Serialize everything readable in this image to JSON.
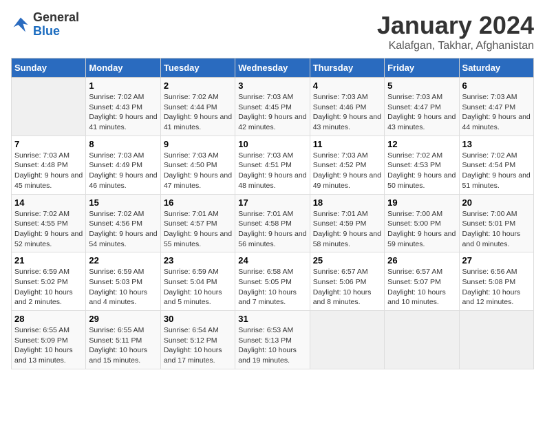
{
  "logo": {
    "general": "General",
    "blue": "Blue"
  },
  "title": "January 2024",
  "subtitle": "Kalafgan, Takhar, Afghanistan",
  "days_of_week": [
    "Sunday",
    "Monday",
    "Tuesday",
    "Wednesday",
    "Thursday",
    "Friday",
    "Saturday"
  ],
  "weeks": [
    [
      {
        "day": "",
        "sunrise": "",
        "sunset": "",
        "daylight": ""
      },
      {
        "day": "1",
        "sunrise": "Sunrise: 7:02 AM",
        "sunset": "Sunset: 4:43 PM",
        "daylight": "Daylight: 9 hours and 41 minutes."
      },
      {
        "day": "2",
        "sunrise": "Sunrise: 7:02 AM",
        "sunset": "Sunset: 4:44 PM",
        "daylight": "Daylight: 9 hours and 41 minutes."
      },
      {
        "day": "3",
        "sunrise": "Sunrise: 7:03 AM",
        "sunset": "Sunset: 4:45 PM",
        "daylight": "Daylight: 9 hours and 42 minutes."
      },
      {
        "day": "4",
        "sunrise": "Sunrise: 7:03 AM",
        "sunset": "Sunset: 4:46 PM",
        "daylight": "Daylight: 9 hours and 43 minutes."
      },
      {
        "day": "5",
        "sunrise": "Sunrise: 7:03 AM",
        "sunset": "Sunset: 4:47 PM",
        "daylight": "Daylight: 9 hours and 43 minutes."
      },
      {
        "day": "6",
        "sunrise": "Sunrise: 7:03 AM",
        "sunset": "Sunset: 4:47 PM",
        "daylight": "Daylight: 9 hours and 44 minutes."
      }
    ],
    [
      {
        "day": "7",
        "sunrise": "Sunrise: 7:03 AM",
        "sunset": "Sunset: 4:48 PM",
        "daylight": "Daylight: 9 hours and 45 minutes."
      },
      {
        "day": "8",
        "sunrise": "Sunrise: 7:03 AM",
        "sunset": "Sunset: 4:49 PM",
        "daylight": "Daylight: 9 hours and 46 minutes."
      },
      {
        "day": "9",
        "sunrise": "Sunrise: 7:03 AM",
        "sunset": "Sunset: 4:50 PM",
        "daylight": "Daylight: 9 hours and 47 minutes."
      },
      {
        "day": "10",
        "sunrise": "Sunrise: 7:03 AM",
        "sunset": "Sunset: 4:51 PM",
        "daylight": "Daylight: 9 hours and 48 minutes."
      },
      {
        "day": "11",
        "sunrise": "Sunrise: 7:03 AM",
        "sunset": "Sunset: 4:52 PM",
        "daylight": "Daylight: 9 hours and 49 minutes."
      },
      {
        "day": "12",
        "sunrise": "Sunrise: 7:02 AM",
        "sunset": "Sunset: 4:53 PM",
        "daylight": "Daylight: 9 hours and 50 minutes."
      },
      {
        "day": "13",
        "sunrise": "Sunrise: 7:02 AM",
        "sunset": "Sunset: 4:54 PM",
        "daylight": "Daylight: 9 hours and 51 minutes."
      }
    ],
    [
      {
        "day": "14",
        "sunrise": "Sunrise: 7:02 AM",
        "sunset": "Sunset: 4:55 PM",
        "daylight": "Daylight: 9 hours and 52 minutes."
      },
      {
        "day": "15",
        "sunrise": "Sunrise: 7:02 AM",
        "sunset": "Sunset: 4:56 PM",
        "daylight": "Daylight: 9 hours and 54 minutes."
      },
      {
        "day": "16",
        "sunrise": "Sunrise: 7:01 AM",
        "sunset": "Sunset: 4:57 PM",
        "daylight": "Daylight: 9 hours and 55 minutes."
      },
      {
        "day": "17",
        "sunrise": "Sunrise: 7:01 AM",
        "sunset": "Sunset: 4:58 PM",
        "daylight": "Daylight: 9 hours and 56 minutes."
      },
      {
        "day": "18",
        "sunrise": "Sunrise: 7:01 AM",
        "sunset": "Sunset: 4:59 PM",
        "daylight": "Daylight: 9 hours and 58 minutes."
      },
      {
        "day": "19",
        "sunrise": "Sunrise: 7:00 AM",
        "sunset": "Sunset: 5:00 PM",
        "daylight": "Daylight: 9 hours and 59 minutes."
      },
      {
        "day": "20",
        "sunrise": "Sunrise: 7:00 AM",
        "sunset": "Sunset: 5:01 PM",
        "daylight": "Daylight: 10 hours and 0 minutes."
      }
    ],
    [
      {
        "day": "21",
        "sunrise": "Sunrise: 6:59 AM",
        "sunset": "Sunset: 5:02 PM",
        "daylight": "Daylight: 10 hours and 2 minutes."
      },
      {
        "day": "22",
        "sunrise": "Sunrise: 6:59 AM",
        "sunset": "Sunset: 5:03 PM",
        "daylight": "Daylight: 10 hours and 4 minutes."
      },
      {
        "day": "23",
        "sunrise": "Sunrise: 6:59 AM",
        "sunset": "Sunset: 5:04 PM",
        "daylight": "Daylight: 10 hours and 5 minutes."
      },
      {
        "day": "24",
        "sunrise": "Sunrise: 6:58 AM",
        "sunset": "Sunset: 5:05 PM",
        "daylight": "Daylight: 10 hours and 7 minutes."
      },
      {
        "day": "25",
        "sunrise": "Sunrise: 6:57 AM",
        "sunset": "Sunset: 5:06 PM",
        "daylight": "Daylight: 10 hours and 8 minutes."
      },
      {
        "day": "26",
        "sunrise": "Sunrise: 6:57 AM",
        "sunset": "Sunset: 5:07 PM",
        "daylight": "Daylight: 10 hours and 10 minutes."
      },
      {
        "day": "27",
        "sunrise": "Sunrise: 6:56 AM",
        "sunset": "Sunset: 5:08 PM",
        "daylight": "Daylight: 10 hours and 12 minutes."
      }
    ],
    [
      {
        "day": "28",
        "sunrise": "Sunrise: 6:55 AM",
        "sunset": "Sunset: 5:09 PM",
        "daylight": "Daylight: 10 hours and 13 minutes."
      },
      {
        "day": "29",
        "sunrise": "Sunrise: 6:55 AM",
        "sunset": "Sunset: 5:11 PM",
        "daylight": "Daylight: 10 hours and 15 minutes."
      },
      {
        "day": "30",
        "sunrise": "Sunrise: 6:54 AM",
        "sunset": "Sunset: 5:12 PM",
        "daylight": "Daylight: 10 hours and 17 minutes."
      },
      {
        "day": "31",
        "sunrise": "Sunrise: 6:53 AM",
        "sunset": "Sunset: 5:13 PM",
        "daylight": "Daylight: 10 hours and 19 minutes."
      },
      {
        "day": "",
        "sunrise": "",
        "sunset": "",
        "daylight": ""
      },
      {
        "day": "",
        "sunrise": "",
        "sunset": "",
        "daylight": ""
      },
      {
        "day": "",
        "sunrise": "",
        "sunset": "",
        "daylight": ""
      }
    ]
  ]
}
